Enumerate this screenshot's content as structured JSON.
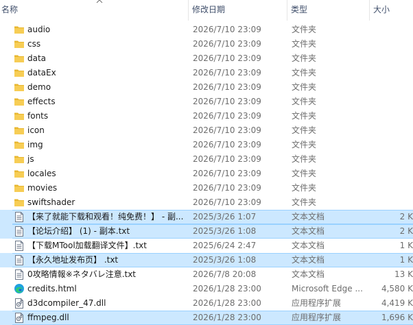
{
  "columns": {
    "name": "名称",
    "date": "修改日期",
    "type": "类型",
    "size": "大小"
  },
  "files": [
    {
      "name": "audio",
      "date": "2026/7/10 23:09",
      "type": "文件夹",
      "size": "",
      "icon": "folder-icon",
      "selected": false
    },
    {
      "name": "css",
      "date": "2026/7/10 23:09",
      "type": "文件夹",
      "size": "",
      "icon": "folder-icon",
      "selected": false
    },
    {
      "name": "data",
      "date": "2026/7/10 23:09",
      "type": "文件夹",
      "size": "",
      "icon": "folder-icon",
      "selected": false
    },
    {
      "name": "dataEx",
      "date": "2026/7/10 23:09",
      "type": "文件夹",
      "size": "",
      "icon": "folder-icon",
      "selected": false
    },
    {
      "name": "demo",
      "date": "2026/7/10 23:09",
      "type": "文件夹",
      "size": "",
      "icon": "folder-icon",
      "selected": false
    },
    {
      "name": "effects",
      "date": "2026/7/10 23:09",
      "type": "文件夹",
      "size": "",
      "icon": "folder-icon",
      "selected": false
    },
    {
      "name": "fonts",
      "date": "2026/7/10 23:09",
      "type": "文件夹",
      "size": "",
      "icon": "folder-icon",
      "selected": false
    },
    {
      "name": "icon",
      "date": "2026/7/10 23:09",
      "type": "文件夹",
      "size": "",
      "icon": "folder-icon",
      "selected": false
    },
    {
      "name": "img",
      "date": "2026/7/10 23:09",
      "type": "文件夹",
      "size": "",
      "icon": "folder-icon",
      "selected": false
    },
    {
      "name": "js",
      "date": "2026/7/10 23:09",
      "type": "文件夹",
      "size": "",
      "icon": "folder-icon",
      "selected": false
    },
    {
      "name": "locales",
      "date": "2026/7/10 23:09",
      "type": "文件夹",
      "size": "",
      "icon": "folder-icon",
      "selected": false
    },
    {
      "name": "movies",
      "date": "2026/7/10 23:09",
      "type": "文件夹",
      "size": "",
      "icon": "folder-icon",
      "selected": false
    },
    {
      "name": "swiftshader",
      "date": "2026/7/10 23:09",
      "type": "文件夹",
      "size": "",
      "icon": "folder-icon",
      "selected": false
    },
    {
      "name": "【来了就能下载和观看！纯免费！】 - 副...",
      "date": "2025/3/26 1:07",
      "type": "文本文档",
      "size": "2 K",
      "icon": "text-file-icon",
      "selected": true
    },
    {
      "name": "【论坛介绍】 (1) - 副本.txt",
      "date": "2025/3/26 1:08",
      "type": "文本文档",
      "size": "2 K",
      "icon": "text-file-icon",
      "selected": true
    },
    {
      "name": "【下载MTool加载翻译文件】.txt",
      "date": "2025/6/24 2:47",
      "type": "文本文档",
      "size": "1 K",
      "icon": "text-file-icon",
      "selected": false
    },
    {
      "name": "【永久地址发布页】 .txt",
      "date": "2025/3/26 1:08",
      "type": "文本文档",
      "size": "1 K",
      "icon": "text-file-icon",
      "selected": true
    },
    {
      "name": "0攻略情報※ネタバレ注意.txt",
      "date": "2026/7/8 20:08",
      "type": "文本文档",
      "size": "13 K",
      "icon": "text-file-icon",
      "selected": false
    },
    {
      "name": "credits.html",
      "date": "2026/1/28 23:00",
      "type": "Microsoft Edge ...",
      "size": "4,580 K",
      "icon": "edge-icon",
      "selected": false
    },
    {
      "name": "d3dcompiler_47.dll",
      "date": "2026/1/28 23:00",
      "type": "应用程序扩展",
      "size": "4,419 K",
      "icon": "dll-file-icon",
      "selected": false
    },
    {
      "name": "ffmpeg.dll",
      "date": "2026/1/28 23:00",
      "type": "应用程序扩展",
      "size": "1,696 K",
      "icon": "dll-file-icon",
      "selected": true
    }
  ],
  "colors": {
    "selection": "#cce8ff",
    "folder": "#f4c542",
    "header_text": "#3f4e6a",
    "detail_text": "#6d6d6d"
  }
}
